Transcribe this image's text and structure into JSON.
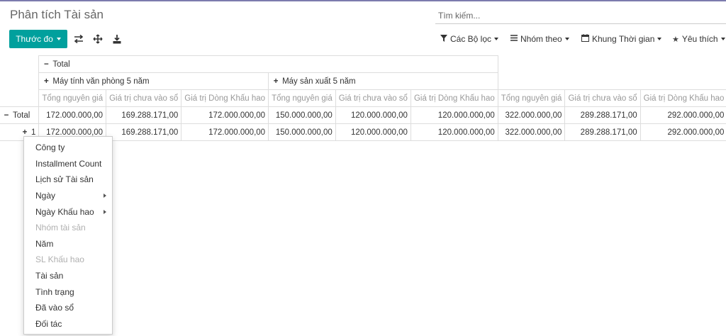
{
  "page_title": "Phân tích Tài sản",
  "search": {
    "placeholder": "Tìm kiếm..."
  },
  "toolbar": {
    "measure_label": "Thước đo",
    "icons": [
      "swap-axes-icon",
      "expand-all-icon",
      "download-icon"
    ]
  },
  "filters": {
    "filter_label": "Các Bộ lọc",
    "group_by_label": "Nhóm theo",
    "time_range_label": "Khung Thời gian",
    "favorites_label": "Yêu thích"
  },
  "pivot": {
    "total_header": "Total",
    "col_groups": [
      "Máy tính văn phòng 5 năm",
      "Máy sản xuất 5 năm"
    ],
    "measures": [
      "Tổng nguyên giá",
      "Giá trị chưa vào sổ",
      "Giá trị Dòng Khấu hao"
    ],
    "rows": [
      {
        "label": "Total",
        "sign": "−",
        "values": [
          "172.000.000,00",
          "169.288.171,00",
          "172.000.000,00",
          "150.000.000,00",
          "120.000.000,00",
          "120.000.000,00",
          "322.000.000,00",
          "289.288.171,00",
          "292.000.000,00"
        ]
      },
      {
        "label": "1",
        "sign": "+",
        "values": [
          "172.000.000,00",
          "169.288.171,00",
          "172.000.000,00",
          "150.000.000,00",
          "120.000.000,00",
          "120.000.000,00",
          "322.000.000,00",
          "289.288.171,00",
          "292.000.000,00"
        ]
      }
    ]
  },
  "groupby_menu": {
    "items": [
      {
        "label": "Công ty"
      },
      {
        "label": "Installment Count"
      },
      {
        "label": "Lịch sử Tài sản"
      },
      {
        "label": "Ngày",
        "submenu": true
      },
      {
        "label": "Ngày Khấu hao",
        "submenu": true
      },
      {
        "label": "Nhóm tài sản",
        "disabled": true
      },
      {
        "label": "Năm"
      },
      {
        "label": "SL Khấu hao",
        "disabled": true
      },
      {
        "label": "Tài sản"
      },
      {
        "label": "Tình trạng"
      },
      {
        "label": "Đã vào sổ"
      },
      {
        "label": "Đối tác"
      }
    ]
  }
}
